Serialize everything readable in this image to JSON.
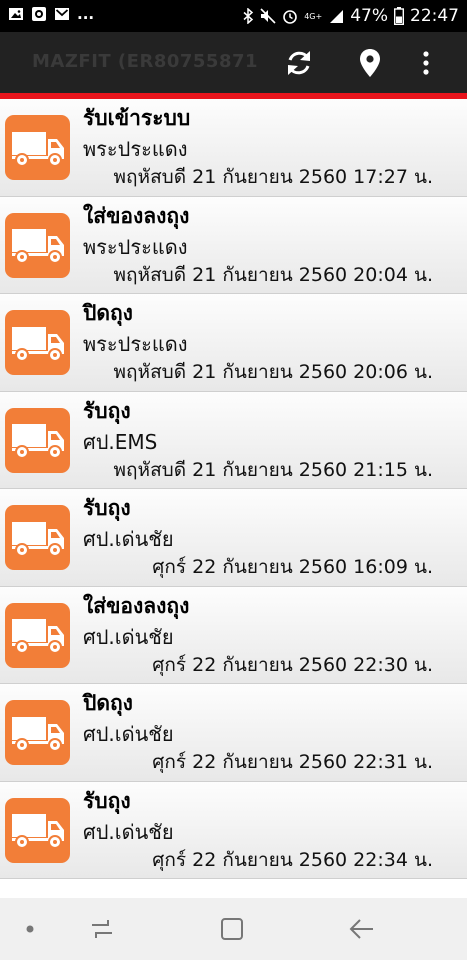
{
  "status_bar": {
    "left_icons": [
      "image-icon",
      "record-icon",
      "gmail-icon"
    ],
    "overflow": "...",
    "right_icons": [
      "bluetooth-icon",
      "mute-icon",
      "alarm-icon",
      "network-icon",
      "signal-icon"
    ],
    "network_label": "4G+",
    "battery": "47%",
    "time": "22:47"
  },
  "app_bar": {
    "title": "MAZFIT  (ER80755871",
    "actions": [
      "refresh-icon",
      "location-pin-icon",
      "more-options-icon"
    ]
  },
  "accent_colors": {
    "divider": "#e8141c",
    "tile": "#f27e38",
    "app_bar": "#222222"
  },
  "tracking_events": [
    {
      "status": "รับเข้าระบบ",
      "location": "พระประแดง",
      "datetime": "พฤหัสบดี 21 กันยายน 2560 17:27 น."
    },
    {
      "status": "ใส่ของลงถุง",
      "location": "พระประแดง",
      "datetime": "พฤหัสบดี 21 กันยายน 2560 20:04 น."
    },
    {
      "status": "ปิดถุง",
      "location": "พระประแดง",
      "datetime": "พฤหัสบดี 21 กันยายน 2560 20:06 น."
    },
    {
      "status": "รับถุง",
      "location": "ศป.EMS",
      "datetime": "พฤหัสบดี 21 กันยายน 2560 21:15 น."
    },
    {
      "status": "รับถุง",
      "location": "ศป.เด่นชัย",
      "datetime": "ศุกร์ 22 กันยายน 2560 16:09 น."
    },
    {
      "status": "ใส่ของลงถุง",
      "location": "ศป.เด่นชัย",
      "datetime": "ศุกร์ 22 กันยายน 2560 22:30 น."
    },
    {
      "status": "ปิดถุง",
      "location": "ศป.เด่นชัย",
      "datetime": "ศุกร์ 22 กันยายน 2560 22:31 น."
    },
    {
      "status": "รับถุง",
      "location": "ศป.เด่นชัย",
      "datetime": "ศุกร์ 22 กันยายน 2560 22:34 น."
    }
  ],
  "nav_bar": {
    "buttons": [
      "dot-icon",
      "recent-apps-icon",
      "home-icon",
      "back-icon"
    ]
  }
}
